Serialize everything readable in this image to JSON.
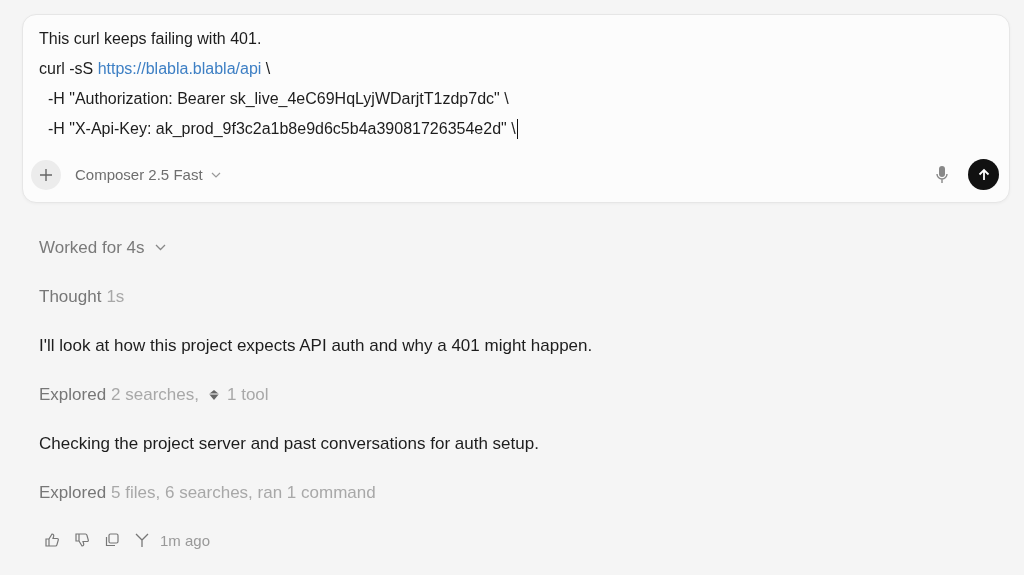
{
  "composer": {
    "lines": [
      {
        "kind": "plain",
        "text": "This curl keeps failing with 401."
      },
      {
        "kind": "link",
        "prefix": "curl -sS ",
        "link": "https://blabla.blabla/api",
        "suffix": " \\"
      },
      {
        "kind": "plain",
        "text": "  -H \"Authorization: Bearer sk_live_4eC69HqLyjWDarjtT1zdp7dc\" \\"
      },
      {
        "kind": "plain",
        "text": "  -H \"X-Api-Key: ak_prod_9f3c2a1b8e9d6c5b4a39081726354e2d\" \\"
      }
    ],
    "model": "Composer 2.5 Fast"
  },
  "steps": [
    {
      "kind": "summary",
      "text": "Worked for 4s"
    },
    {
      "kind": "thought",
      "label": "Thought",
      "detail": "1s"
    },
    {
      "kind": "message",
      "text": "I'll look at how this project expects API auth and why a 401 might happen."
    },
    {
      "kind": "explored",
      "label": "Explored",
      "parts": [
        {
          "kind": "text",
          "text": "2 searches,"
        },
        {
          "kind": "tool",
          "text": "1 tool"
        }
      ]
    },
    {
      "kind": "message",
      "text": "Checking the project server and past conversations for auth setup."
    },
    {
      "kind": "explored",
      "label": "Explored",
      "parts": [
        {
          "kind": "text",
          "text": "5 files, 6 searches, ran 1 command"
        }
      ]
    }
  ],
  "footer": {
    "time": "1m ago"
  }
}
